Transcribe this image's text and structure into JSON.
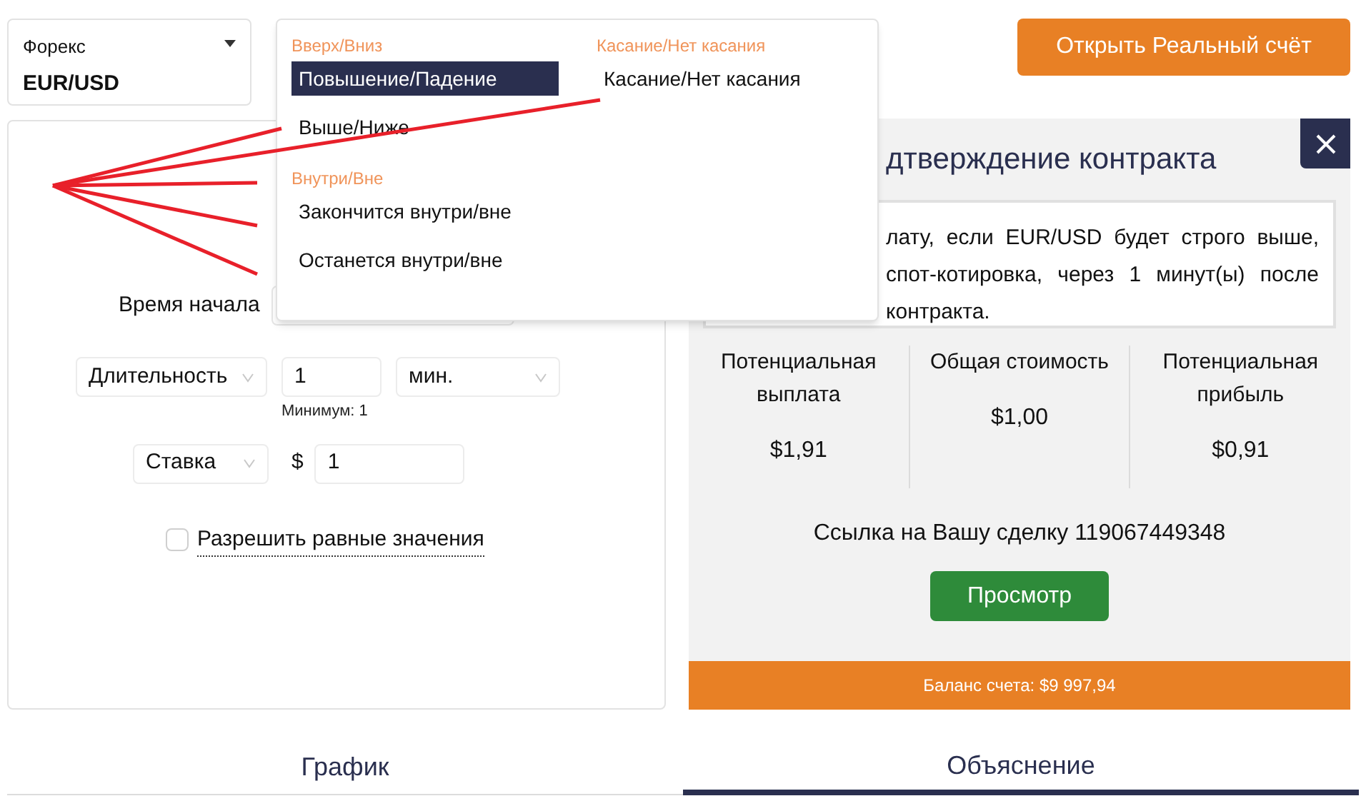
{
  "instrument": {
    "category": "Форекс",
    "symbol": "EUR/USD"
  },
  "contract_menu": {
    "columns": [
      [
        {
          "header": "Вверх/Вниз",
          "items": [
            {
              "label": "Повышение/Падение",
              "selected": true
            },
            {
              "label": "Выше/Ниже",
              "selected": false
            }
          ]
        },
        {
          "header": "Внутри/Вне",
          "items": [
            {
              "label": "Закончится внутри/вне",
              "selected": false
            },
            {
              "label": "Останется внутри/вне",
              "selected": false
            }
          ]
        }
      ],
      [
        {
          "header": "Касание/Нет касания",
          "items": [
            {
              "label": "Касание/Нет касания",
              "selected": false
            }
          ]
        }
      ]
    ]
  },
  "form": {
    "start_time_label": "Время начала",
    "duration": {
      "select": "Длительность",
      "value": "1",
      "unit": "мин.",
      "hint": "Минимум: 1"
    },
    "stake": {
      "select": "Ставка",
      "currency": "$",
      "value": "1"
    },
    "allow_equals": {
      "label": "Разрешить равные значения",
      "checked": false
    }
  },
  "open_account_button": "Открыть Реальный счёт",
  "confirmation": {
    "title": "дтверждение контракта",
    "description_lines": [
      "лату, если EUR/USD будет строго выше,",
      "спот-котировка, через 1 минут(ы) после",
      "контракта."
    ],
    "stats": [
      {
        "label": "Потенциальная выплата",
        "value": "$1,91"
      },
      {
        "label": "Общая стоимость",
        "value": "$1,00"
      },
      {
        "label": "Потенциальная прибыль",
        "value": "$0,91"
      }
    ],
    "reference": "Ссылка на Вашу сделку 119067449348",
    "view_button": "Просмотр",
    "balance": "Баланс счета: $9 997,94"
  },
  "tabs": [
    {
      "label": "График",
      "selected": false
    },
    {
      "label": "Объяснение",
      "selected": true
    }
  ]
}
